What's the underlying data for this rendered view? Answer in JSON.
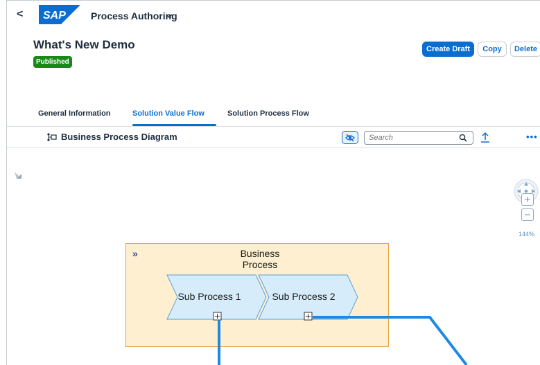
{
  "shell": {
    "back_label": "<",
    "logo_text": "SAP",
    "app_title": "Process Authoring",
    "app_menu_icon": "chevron-down-icon"
  },
  "header": {
    "title": "What's New Demo",
    "status": "Published",
    "status_color": "#188918",
    "actions": {
      "create_draft": "Create Draft",
      "copy": "Copy",
      "delete": "Delete"
    }
  },
  "tabs": [
    {
      "label": "General Information",
      "active": false
    },
    {
      "label": "Solution Value Flow",
      "active": true
    },
    {
      "label": "Solution Process Flow",
      "active": false
    }
  ],
  "toolbar": {
    "title": "Business Process Diagram",
    "search_placeholder": "Search",
    "more_label": "•••"
  },
  "canvas": {
    "zoom_level": "144%",
    "zoom_in_label": "+",
    "zoom_out_label": "−",
    "business_process": {
      "chevron_glyph": "»",
      "title": "Business Process",
      "sub_processes": [
        "Sub Process 1",
        "Sub Process 2"
      ]
    }
  },
  "colors": {
    "accent": "#0a6ed1",
    "process_fill": "#fdefcf",
    "process_border": "#e2a63b",
    "subprocess_fill": "#d6ecfa",
    "connector": "#1e88e5"
  }
}
